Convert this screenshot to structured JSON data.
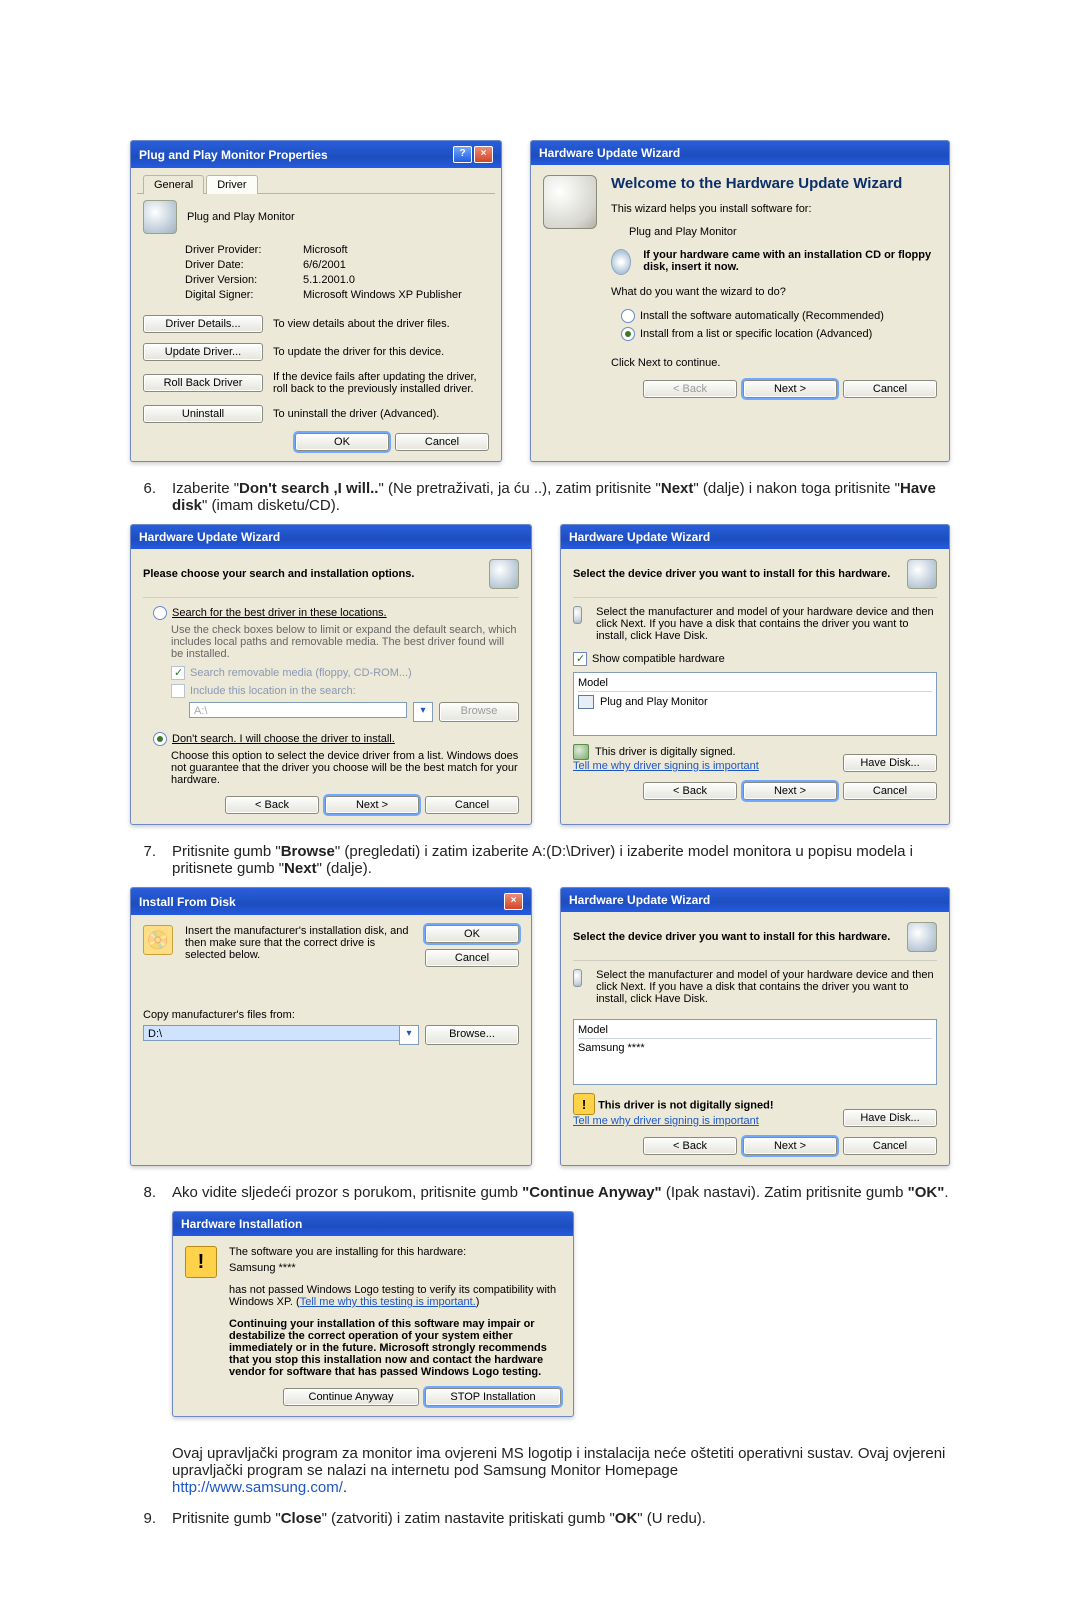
{
  "propWin": {
    "title": "Plug and Play Monitor Properties",
    "tabs": {
      "general": "General",
      "driver": "Driver"
    },
    "device": "Plug and Play Monitor",
    "rows": {
      "provider_l": "Driver Provider:",
      "provider_v": "Microsoft",
      "date_l": "Driver Date:",
      "date_v": "6/6/2001",
      "ver_l": "Driver Version:",
      "ver_v": "5.1.2001.0",
      "signer_l": "Digital Signer:",
      "signer_v": "Microsoft Windows XP Publisher"
    },
    "btns": {
      "details": "Driver Details...",
      "details_d": "To view details about the driver files.",
      "update": "Update Driver...",
      "update_d": "To update the driver for this device.",
      "rollback": "Roll Back Driver",
      "rollback_d": "If the device fails after updating the driver, roll back to the previously installed driver.",
      "uninstall": "Uninstall",
      "uninstall_d": "To uninstall the driver (Advanced)."
    },
    "ok": "OK",
    "cancel": "Cancel"
  },
  "wizWelcome": {
    "title": "Hardware Update Wizard",
    "h": "Welcome to the Hardware Update Wizard",
    "p1": "This wizard helps you install software for:",
    "device": "Plug and Play Monitor",
    "cdline": "If your hardware came with an installation CD or floppy disk, insert it now.",
    "q": "What do you want the wizard to do?",
    "opt1": "Install the software automatically (Recommended)",
    "opt2": "Install from a list or specific location (Advanced)",
    "nextline": "Click Next to continue.",
    "back": "< Back",
    "next": "Next >",
    "cancel": "Cancel"
  },
  "step6": {
    "num": "6.",
    "text_a": "Izaberite \"",
    "b1": "Don't search ,I will..",
    "text_b": "\" (Ne pretraživati, ja ću ..), zatim pritisnite \"",
    "b2": "Next",
    "text_c": "\" (dalje) i nakon toga pritisnite \"",
    "b3": "Have disk",
    "text_d": "\" (imam disketu/CD)."
  },
  "wizSearch": {
    "title": "Hardware Update Wizard",
    "h": "Please choose your search and installation options.",
    "r1": "Search for the best driver in these locations.",
    "r1d": "Use the check boxes below to limit or expand the default search, which includes local paths and removable media. The best driver found will be installed.",
    "c1": "Search removable media (floppy, CD-ROM...)",
    "c2": "Include this location in the search:",
    "path": "A:\\",
    "browse": "Browse",
    "r2": "Don't search. I will choose the driver to install.",
    "r2d": "Choose this option to select the device driver from a list. Windows does not guarantee that the driver you choose will be the best match for your hardware.",
    "back": "< Back",
    "next": "Next >",
    "cancel": "Cancel"
  },
  "wizSelect1": {
    "title": "Hardware Update Wizard",
    "h": "Select the device driver you want to install for this hardware.",
    "d": "Select the manufacturer and model of your hardware device and then click Next. If you have a disk that contains the driver you want to install, click Have Disk.",
    "compat": "Show compatible hardware",
    "model_h": "Model",
    "model_v": "Plug and Play Monitor",
    "signed": "This driver is digitally signed.",
    "tell": "Tell me why driver signing is important",
    "havedisk": "Have Disk...",
    "back": "< Back",
    "next": "Next >",
    "cancel": "Cancel"
  },
  "step7": {
    "num": "7.",
    "text_a": "Pritisnite gumb \"",
    "b1": "Browse",
    "text_b": "\" (pregledati) i zatim izaberite A:(D:\\Driver) i izaberite model monitora u popisu modela i pritisnete gumb \"",
    "b2": "Next",
    "text_c": "\" (dalje)."
  },
  "installFrom": {
    "title": "Install From Disk",
    "msg": "Insert the manufacturer's installation disk, and then make sure that the correct drive is selected below.",
    "ok": "OK",
    "cancel": "Cancel",
    "copy": "Copy manufacturer's files from:",
    "path": "D:\\",
    "browse": "Browse..."
  },
  "wizSelect2": {
    "title": "Hardware Update Wizard",
    "h": "Select the device driver you want to install for this hardware.",
    "d": "Select the manufacturer and model of your hardware device and then click Next. If you have a disk that contains the driver you want to install, click Have Disk.",
    "model_h": "Model",
    "model_v": "Samsung ****",
    "nosigned": "This driver is not digitally signed!",
    "tell": "Tell me why driver signing is important",
    "havedisk": "Have Disk...",
    "back": "< Back",
    "next": "Next >",
    "cancel": "Cancel"
  },
  "step8": {
    "num": "8.",
    "text_a": "Ako vidite sljedeći prozor s porukom, pritisnite gumb ",
    "b1": "\"Continue Anyway\"",
    "text_b": " (Ipak nastavi). Zatim pritisnite gumb ",
    "b2": "\"OK\"",
    "text_c": "."
  },
  "hwInstall": {
    "title": "Hardware Installation",
    "l1": "The software you are installing for this hardware:",
    "dev": "Samsung ****",
    "l2a": "has not passed Windows Logo testing to verify its compatibility with Windows XP. (",
    "l2link": "Tell me why this testing is important.",
    "l2b": ")",
    "warn": "Continuing your installation of this software may impair or destabilize the correct operation of your system either immediately or in the future. Microsoft strongly recommends that you stop this installation now and contact the hardware vendor for software that has passed Windows Logo testing.",
    "cont": "Continue Anyway",
    "stop": "STOP Installation"
  },
  "tail": {
    "p1": "Ovaj upravljački program za monitor ima ovjereni MS logotip i instalacija neće oštetiti operativni sustav. Ovaj ovjereni upravljački program se nalazi na internetu pod Samsung Monitor Homepage",
    "url": "http://www.samsung.com/",
    "urlperiod": "."
  },
  "step9": {
    "num": "9.",
    "text_a": "Pritisnite gumb \"",
    "b1": "Close",
    "text_b": "\" (zatvoriti) i zatim nastavite pritiskati gumb \"",
    "b2": "OK",
    "text_c": "\" (U redu)."
  }
}
